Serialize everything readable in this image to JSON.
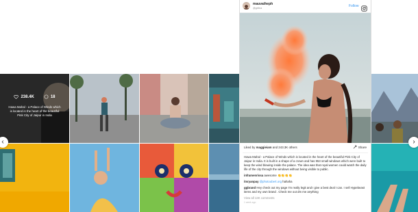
{
  "overlay": {
    "likes": "238.4K",
    "comments": "18",
    "caption": "Hawa Mahal - a Palace of Winds which is located in the heart of the beautiful Pink City of Jaipur in India"
  },
  "modal": {
    "username": "mauvaiheph",
    "handle": "@gelina",
    "follow_label": "Follow",
    "likes_prefix": "Liked by",
    "likes_user": "maggieiam",
    "likes_suffix": "and 243.3K others",
    "share_label": "Share",
    "caption": "Hawa Mahal - a Palace of Winds which is located in the heart of the beautiful Pink City of Jaipur in India. It is built in a shape of a crown and has 953 small windows which were built to keep the wind blowing inside the palace. The idea was that royal women could watch the daily life of the city through the windows without being visible to public.",
    "comments": [
      {
        "user": "inframenrissa",
        "text": "awesome 👏👏👏👏",
        "mention": ""
      },
      {
        "user": "itsryanpay",
        "mention": "@photoubert.org",
        "text": "hahaha"
      },
      {
        "user": "ggbrand",
        "mention": "",
        "text": "Hey check out my page I'm really legit and I give a best deal I can. I sell Hypebeast items and my own brand . Check me out dm me anything"
      }
    ],
    "view_all": "View all 13K comments",
    "time": "1 week ago"
  },
  "nav": {
    "prev": "‹",
    "next": "›"
  },
  "colors": {
    "accent": "#3897f0",
    "text": "#262626",
    "muted": "#8e8e8e"
  }
}
